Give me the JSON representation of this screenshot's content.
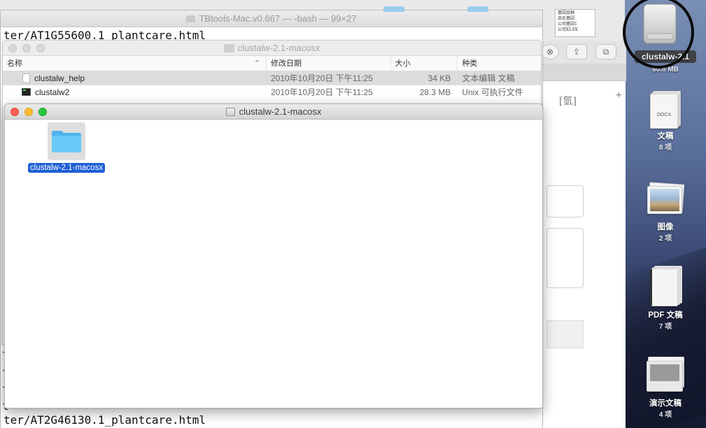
{
  "terminal": {
    "title": "TBtools-Mac.v0.667 — -bash — 99×27",
    "line_top": "ter/AT1G55600.1_plantcare.html",
    "line_bottom": "ter/AT2G46130.1_plantcare.html",
    "fragments": [
      "t",
      "t",
      "t",
      "t"
    ]
  },
  "finder_list": {
    "title": "clustalw-2.1-macosx",
    "columns": {
      "name": "名称",
      "date": "修改日期",
      "size": "大小",
      "kind": "种类"
    },
    "rows": [
      {
        "name": "clustalw_help",
        "date": "2010年10月20日 下午11:25",
        "size": "34 KB",
        "kind": "文本编辑 文稿",
        "icon": "text-document-icon"
      },
      {
        "name": "clustalw2",
        "date": "2010年10月20日 下午11:25",
        "size": "28.3 MB",
        "kind": "Unix 可执行文件",
        "icon": "terminal-exec-icon"
      }
    ]
  },
  "finder_icon": {
    "title": "clustalw-2.1-macosx",
    "items": [
      {
        "label": "clustalw-2.1-macosx",
        "icon": "folder-icon",
        "selected": true
      }
    ]
  },
  "browser": {
    "bracket_text": "[氫]",
    "new_tab": "+"
  },
  "xlsx_thumb": {
    "lines": [
      "基因品种",
      "品氏基因",
      "公司基因1",
      "公司XLSX"
    ]
  },
  "desktop": {
    "disk": {
      "label": "clustalw-2.1",
      "size": "60.8 MB"
    },
    "stacks": [
      {
        "label": "文稿",
        "count": "8 项",
        "icon": "docx-stack-icon"
      },
      {
        "label": "图像",
        "count": "2 项",
        "icon": "image-stack-icon"
      },
      {
        "label": "PDF 文稿",
        "count": "7 项",
        "icon": "pdf-stack-icon"
      },
      {
        "label": "演示文稿",
        "count": "4 项",
        "icon": "presentation-stack-icon"
      }
    ]
  },
  "colors": {
    "selection": "#1e5fd6",
    "folder": "#5ec3f5",
    "close": "#fe5f57",
    "minimize": "#febc2e",
    "zoom": "#28c840"
  }
}
